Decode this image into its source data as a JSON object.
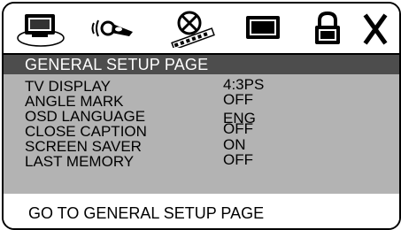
{
  "toolbar": {
    "icons": [
      {
        "name": "general-setup-icon",
        "selected": true
      },
      {
        "name": "audio-setup-icon"
      },
      {
        "name": "disc-setup-icon"
      },
      {
        "name": "video-setup-icon"
      },
      {
        "name": "password-lock-icon"
      },
      {
        "name": "exit-icon",
        "glyph": "X"
      }
    ]
  },
  "page": {
    "title": "GENERAL SETUP PAGE",
    "items": [
      {
        "label": "TV DISPLAY",
        "value": "4:3PS"
      },
      {
        "label": "ANGLE MARK",
        "value": "OFF"
      },
      {
        "label": "OSD LANGUAGE",
        "value": "ENG"
      },
      {
        "label": "CLOSE CAPTION",
        "value": "OFF"
      },
      {
        "label": "SCREEN SAVER",
        "value": "ON"
      },
      {
        "label": "LAST MEMORY",
        "value": "OFF"
      }
    ]
  },
  "status": {
    "text": "GO TO GENERAL SETUP PAGE"
  },
  "colors": {
    "panel": "#b3b3b3",
    "title_bar": "#4d4d4d",
    "title_text": "#ffffff",
    "border": "#000000"
  }
}
